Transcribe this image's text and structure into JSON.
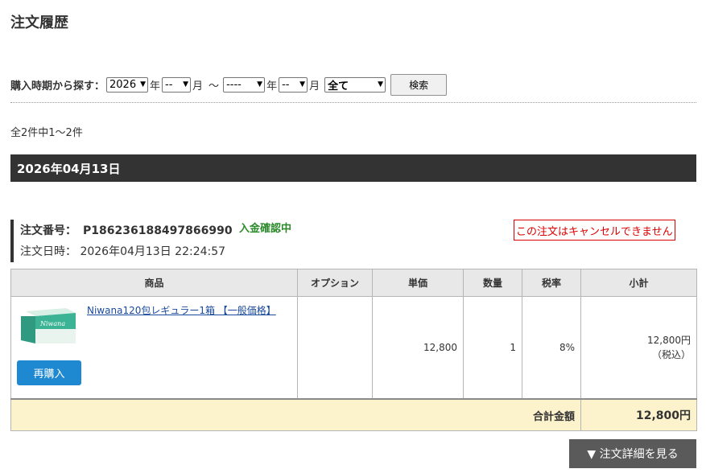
{
  "page_title": "注文履歴",
  "search": {
    "label": "購入時期から探す：",
    "year_from": "2026",
    "month_from": "--",
    "year_to": "----",
    "month_to": "--",
    "status_filter": "全て",
    "year_unit": "年",
    "month_unit": "月",
    "range_sep": "〜",
    "button_label": "検索"
  },
  "result_count": "全2件中1〜2件",
  "date_header": "2026年04月13日",
  "order": {
    "number_label": "注文番号：",
    "number": "P186236188497866990",
    "status": "入金確認中",
    "date_label": "注文日時：",
    "date": "2026年04月13日 22:24:57",
    "cancel_note": "この注文はキャンセルできません"
  },
  "table": {
    "headers": [
      "商品",
      "オプション",
      "単価",
      "数量",
      "税率",
      "小計"
    ],
    "items": [
      {
        "name": "Niwana120包レギュラー1箱 【一般価格】",
        "image_text": "Niwana",
        "option": "",
        "unit_price": "12,800",
        "quantity": "1",
        "tax_rate": "8%",
        "subtotal": "12,800円",
        "tax_note": "（税込）",
        "rebuy_label": "再購入"
      }
    ],
    "total_label": "合計金額",
    "total_value": "12,800円"
  },
  "detail_button": "▼ 注文詳細を見る",
  "colors": {
    "date_bar": "#333333",
    "status_green": "#2a8a2a",
    "cancel_red": "#dd0000",
    "rebuy_blue": "#1e88d0",
    "total_bg": "#fcf3cc",
    "total_red": "#c00000",
    "detail_button_bg": "#5a5a5a"
  }
}
